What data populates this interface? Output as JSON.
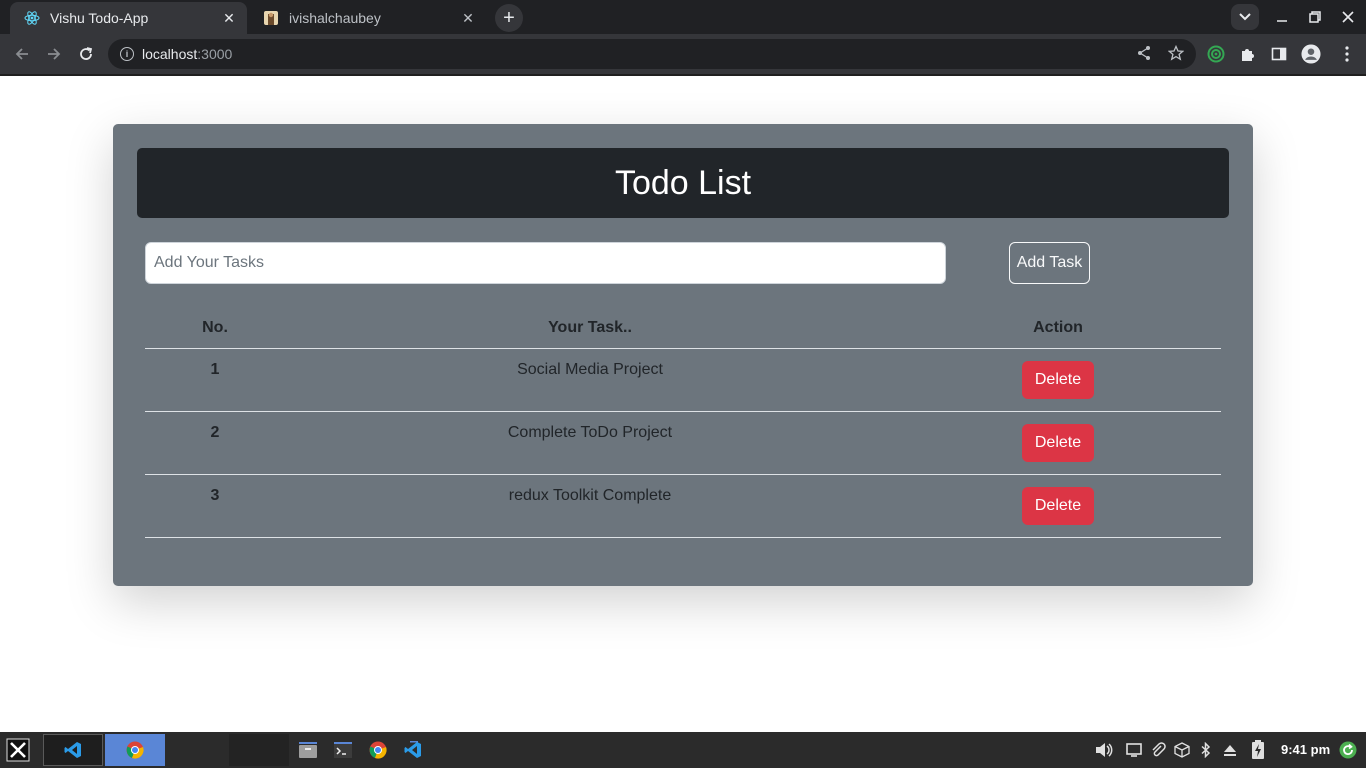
{
  "browser": {
    "tabs": [
      {
        "title": "Vishu Todo-App",
        "active": true,
        "icon": "react-icon"
      },
      {
        "title": "ivishalchaubey",
        "active": false,
        "icon": "profile-favicon"
      }
    ],
    "url_host": "localhost",
    "url_port": ":3000"
  },
  "app": {
    "title": "Todo List",
    "input_placeholder": "Add Your Tasks",
    "input_value": "",
    "add_button": "Add Task",
    "columns": {
      "no": "No.",
      "task": "Your Task..",
      "action": "Action"
    },
    "tasks": [
      {
        "no": "1",
        "task": "Social Media Project",
        "action": "Delete"
      },
      {
        "no": "2",
        "task": "Complete ToDo Project",
        "action": "Delete"
      },
      {
        "no": "3",
        "task": "redux Toolkit Complete",
        "action": "Delete"
      }
    ],
    "colors": {
      "card": "#6c757d",
      "header": "#212529",
      "delete": "#dc3545"
    }
  },
  "taskbar": {
    "time": "9:41 pm"
  }
}
